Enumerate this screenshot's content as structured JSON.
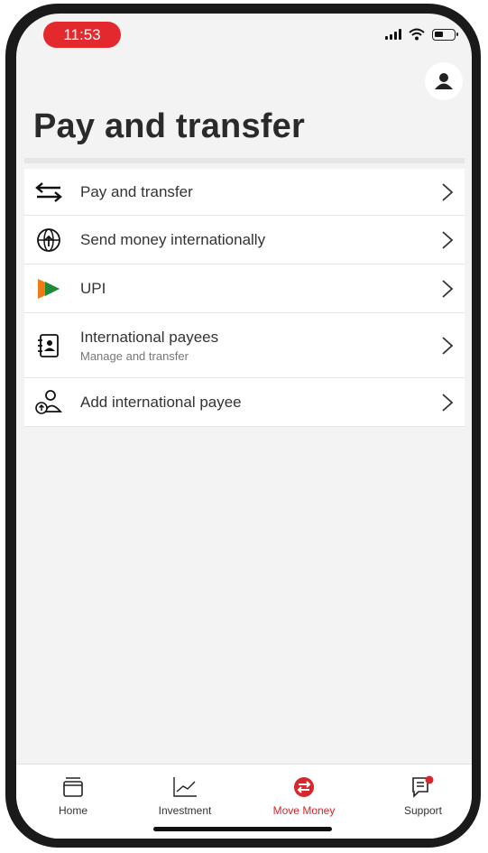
{
  "status_bar": {
    "time": "11:53"
  },
  "header": {
    "title": "Pay and transfer"
  },
  "menu": {
    "items": [
      {
        "label": "Pay and transfer",
        "icon": "swap-arrows-icon"
      },
      {
        "label": "Send money internationally",
        "icon": "globe-send-icon"
      },
      {
        "label": "UPI",
        "icon": "upi-logo-icon"
      },
      {
        "label": "International payees",
        "sublabel": "Manage and transfer",
        "icon": "payee-card-icon"
      },
      {
        "label": "Add international payee",
        "icon": "add-payee-icon"
      }
    ]
  },
  "bottom_nav": {
    "items": [
      {
        "label": "Home",
        "icon": "wallet-icon"
      },
      {
        "label": "Investment",
        "icon": "chart-line-icon"
      },
      {
        "label": "Move Money",
        "icon": "move-money-icon",
        "active": true
      },
      {
        "label": "Support",
        "icon": "support-chat-icon"
      }
    ]
  },
  "colors": {
    "accent": "#e4292e",
    "active_nav": "#d7262c"
  }
}
